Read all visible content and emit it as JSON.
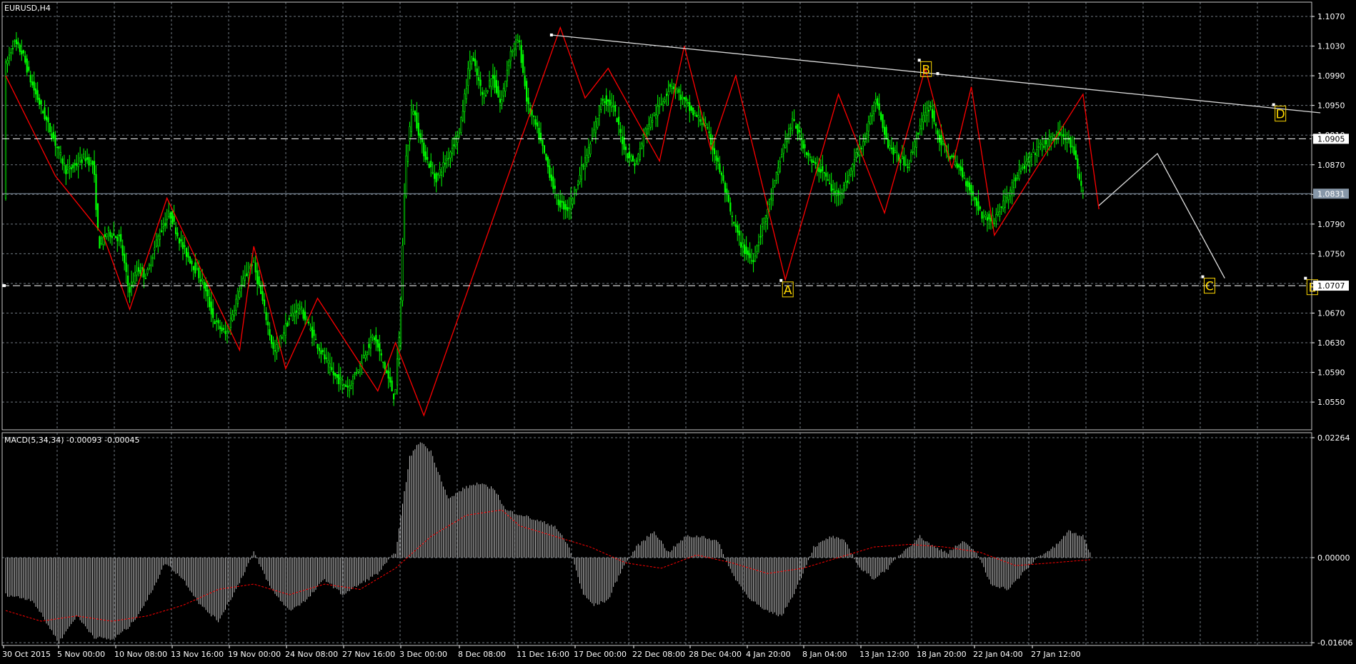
{
  "chart_data": [
    {
      "type": "candlestick",
      "title": "EURUSD,H4",
      "symbol": "EURUSD",
      "timeframe": "H4",
      "ylim": [
        1.0515,
        1.072
      ],
      "yticks": [
        "1.1070",
        "1.1030",
        "1.0990",
        "1.0950",
        "1.0910",
        "1.0870",
        "1.0830",
        "1.0790",
        "1.0750",
        "1.0710",
        "1.0670",
        "1.0630",
        "1.0590",
        "1.0550"
      ],
      "grid": true,
      "x_labels": [
        "30 Oct 2015",
        "5 Nov 00:00",
        "10 Nov 08:00",
        "13 Nov 16:00",
        "19 Nov 00:00",
        "24 Nov 08:00",
        "27 Nov 16:00",
        "3 Dec 00:00",
        "8 Dec 08:00",
        "11 Dec 16:00",
        "17 Dec 00:00",
        "22 Dec 08:00",
        "28 Dec 04:00",
        "4 Jan 20:00",
        "8 Jan 04:00",
        "13 Jan 12:00",
        "18 Jan 20:00",
        "22 Jan 04:00",
        "27 Jan 12:00"
      ],
      "price_path": [
        [
          0,
          1.1
        ],
        [
          5,
          1.1035
        ],
        [
          10,
          1.102
        ],
        [
          15,
          1.098
        ],
        [
          20,
          1.095
        ],
        [
          25,
          1.092
        ],
        [
          30,
          1.089
        ],
        [
          35,
          1.086
        ],
        [
          40,
          1.087
        ],
        [
          45,
          1.088
        ],
        [
          50,
          1.087
        ],
        [
          53,
          1.076
        ],
        [
          58,
          1.078
        ],
        [
          65,
          1.077
        ],
        [
          70,
          1.07
        ],
        [
          75,
          1.073
        ],
        [
          80,
          1.072
        ],
        [
          86,
          1.077
        ],
        [
          93,
          1.0805
        ],
        [
          100,
          1.076
        ],
        [
          105,
          1.074
        ],
        [
          112,
          1.071
        ],
        [
          118,
          1.066
        ],
        [
          125,
          1.064
        ],
        [
          132,
          1.07
        ],
        [
          140,
          1.074
        ],
        [
          146,
          1.068
        ],
        [
          152,
          1.0615
        ],
        [
          160,
          1.066
        ],
        [
          166,
          1.068
        ],
        [
          172,
          1.065
        ],
        [
          178,
          1.062
        ],
        [
          186,
          1.0585
        ],
        [
          194,
          1.057
        ],
        [
          200,
          1.06
        ],
        [
          208,
          1.064
        ],
        [
          214,
          1.06
        ],
        [
          220,
          1.0555
        ],
        [
          223,
          1.065
        ],
        [
          226,
          1.087
        ],
        [
          230,
          1.095
        ],
        [
          236,
          1.089
        ],
        [
          243,
          1.085
        ],
        [
          250,
          1.088
        ],
        [
          257,
          1.092
        ],
        [
          263,
          1.102
        ],
        [
          270,
          1.096
        ],
        [
          275,
          1.099
        ],
        [
          280,
          1.095
        ],
        [
          285,
          1.102
        ],
        [
          290,
          1.104
        ],
        [
          295,
          1.095
        ],
        [
          300,
          1.092
        ],
        [
          305,
          1.088
        ],
        [
          312,
          1.082
        ],
        [
          318,
          1.081
        ],
        [
          325,
          1.086
        ],
        [
          331,
          1.09
        ],
        [
          337,
          1.096
        ],
        [
          343,
          1.095
        ],
        [
          350,
          1.089
        ],
        [
          356,
          1.087
        ],
        [
          362,
          1.092
        ],
        [
          370,
          1.095
        ],
        [
          376,
          1.098
        ],
        [
          382,
          1.096
        ],
        [
          388,
          1.094
        ],
        [
          395,
          1.0925
        ],
        [
          400,
          1.089
        ],
        [
          405,
          1.085
        ],
        [
          410,
          1.08
        ],
        [
          416,
          1.076
        ],
        [
          422,
          1.074
        ],
        [
          428,
          1.079
        ],
        [
          434,
          1.084
        ],
        [
          440,
          1.09
        ],
        [
          445,
          1.093
        ],
        [
          450,
          1.09
        ],
        [
          456,
          1.087
        ],
        [
          462,
          1.086
        ],
        [
          468,
          1.083
        ],
        [
          474,
          1.084
        ],
        [
          480,
          1.088
        ],
        [
          486,
          1.091
        ],
        [
          492,
          1.096
        ],
        [
          498,
          1.09
        ],
        [
          504,
          1.088
        ],
        [
          510,
          1.087
        ],
        [
          516,
          1.092
        ],
        [
          522,
          1.095
        ],
        [
          528,
          1.09
        ],
        [
          534,
          1.088
        ],
        [
          540,
          1.086
        ],
        [
          546,
          1.083
        ],
        [
          552,
          1.08
        ],
        [
          558,
          1.0795
        ],
        [
          564,
          1.082
        ],
        [
          570,
          1.085
        ],
        [
          576,
          1.087
        ],
        [
          582,
          1.089
        ],
        [
          588,
          1.09
        ],
        [
          594,
          1.091
        ],
        [
          600,
          1.0905
        ],
        [
          604,
          1.088
        ],
        [
          608,
          1.0831
        ]
      ],
      "zigzag": [
        [
          0,
          1.099
        ],
        [
          28,
          1.0855
        ],
        [
          55,
          1.0775
        ],
        [
          70,
          1.0675
        ],
        [
          91,
          1.0825
        ],
        [
          132,
          1.062
        ],
        [
          140,
          1.076
        ],
        [
          158,
          1.0595
        ],
        [
          176,
          1.069
        ],
        [
          210,
          1.0565
        ],
        [
          220,
          1.063
        ],
        [
          236,
          1.0532
        ],
        [
          313,
          1.1055
        ],
        [
          327,
          1.096
        ],
        [
          340,
          1.1
        ],
        [
          369,
          1.0875
        ],
        [
          383,
          1.103
        ],
        [
          398,
          1.089
        ],
        [
          412,
          1.099
        ],
        [
          440,
          1.0715
        ],
        [
          470,
          1.0965
        ],
        [
          496,
          1.0805
        ],
        [
          519,
          1.1
        ],
        [
          534,
          1.0865
        ],
        [
          545,
          1.0975
        ],
        [
          558,
          1.0775
        ],
        [
          608,
          1.0965
        ],
        [
          617,
          1.081
        ]
      ],
      "trendline": {
        "from": [
          308,
          1.1045
        ],
        "to": [
          742,
          1.094
        ],
        "color": "#d8d8d8"
      },
      "projection": [
        [
          617,
          1.0815
        ],
        [
          650,
          1.0885
        ],
        [
          688,
          1.0717
        ]
      ],
      "hlines": [
        {
          "label": "1.0905",
          "value": 1.0905,
          "style": "dashed",
          "color": "#ffffff"
        },
        {
          "label": "1.0831",
          "value": 1.0831,
          "style": "solid",
          "color": "#8797a8"
        },
        {
          "label": "1.0707",
          "value": 1.0707,
          "style": "dashed",
          "color": "#ffffff"
        }
      ],
      "wave_labels": [
        {
          "label": "A",
          "x": 438,
          "value": 1.0713
        },
        {
          "label": "B",
          "x": 516,
          "value": 1.101
        },
        {
          "label": "C",
          "x": 676,
          "value": 1.0718
        },
        {
          "label": "D",
          "x": 716,
          "value": 1.095
        },
        {
          "label": "E",
          "x": 734,
          "value": 1.0716
        }
      ],
      "colors": {
        "candles": "#00ff00",
        "zigzag": "#ff0000",
        "grid": "#707880",
        "axis": "#ffffff",
        "label": "#ffd800"
      }
    },
    {
      "type": "histogram",
      "title": "MACD(5,34,34) -0.00093 -0.00045",
      "yticks": [
        "0.02264",
        "0.00000",
        "-0.01606"
      ],
      "ylim": [
        -0.01606,
        0.02264
      ],
      "histogram": [
        [
          0,
          -0.007
        ],
        [
          15,
          -0.008
        ],
        [
          30,
          -0.016
        ],
        [
          40,
          -0.011
        ],
        [
          50,
          -0.015
        ],
        [
          60,
          -0.0155
        ],
        [
          70,
          -0.013
        ],
        [
          80,
          -0.008
        ],
        [
          90,
          -0.001
        ],
        [
          100,
          -0.004
        ],
        [
          110,
          -0.009
        ],
        [
          120,
          -0.012
        ],
        [
          130,
          -0.006
        ],
        [
          140,
          0.001
        ],
        [
          150,
          -0.006
        ],
        [
          160,
          -0.01
        ],
        [
          170,
          -0.008
        ],
        [
          180,
          -0.004
        ],
        [
          190,
          -0.007
        ],
        [
          200,
          -0.005
        ],
        [
          210,
          -0.003
        ],
        [
          220,
          0.001
        ],
        [
          228,
          0.019
        ],
        [
          234,
          0.022
        ],
        [
          240,
          0.02
        ],
        [
          250,
          0.011
        ],
        [
          258,
          0.013
        ],
        [
          266,
          0.014
        ],
        [
          276,
          0.013
        ],
        [
          282,
          0.009
        ],
        [
          292,
          0.008
        ],
        [
          300,
          0.007
        ],
        [
          310,
          0.006
        ],
        [
          318,
          0.002
        ],
        [
          326,
          -0.007
        ],
        [
          332,
          -0.009
        ],
        [
          340,
          -0.008
        ],
        [
          348,
          -0.002
        ],
        [
          356,
          0.002
        ],
        [
          366,
          0.005
        ],
        [
          374,
          0.001
        ],
        [
          384,
          0.004
        ],
        [
          394,
          0.004
        ],
        [
          402,
          0.003
        ],
        [
          410,
          -0.003
        ],
        [
          418,
          -0.007
        ],
        [
          428,
          -0.01
        ],
        [
          438,
          -0.011
        ],
        [
          446,
          -0.006
        ],
        [
          456,
          0.002
        ],
        [
          466,
          0.004
        ],
        [
          474,
          0.003
        ],
        [
          482,
          -0.002
        ],
        [
          490,
          -0.004
        ],
        [
          498,
          -0.002
        ],
        [
          506,
          0.001
        ],
        [
          516,
          0.004
        ],
        [
          524,
          0.002
        ],
        [
          532,
          0.001
        ],
        [
          540,
          0.003
        ],
        [
          548,
          0.001
        ],
        [
          556,
          -0.005
        ],
        [
          566,
          -0.006
        ],
        [
          574,
          -0.003
        ],
        [
          582,
          0.0
        ],
        [
          592,
          0.002
        ],
        [
          600,
          0.005
        ],
        [
          608,
          0.004
        ],
        [
          612,
          0.001
        ]
      ],
      "signal": [
        [
          0,
          -0.01
        ],
        [
          20,
          -0.012
        ],
        [
          40,
          -0.011
        ],
        [
          60,
          -0.012
        ],
        [
          80,
          -0.011
        ],
        [
          100,
          -0.009
        ],
        [
          120,
          -0.006
        ],
        [
          140,
          -0.005
        ],
        [
          160,
          -0.007
        ],
        [
          180,
          -0.005
        ],
        [
          200,
          -0.006
        ],
        [
          220,
          -0.002
        ],
        [
          240,
          0.004
        ],
        [
          260,
          0.008
        ],
        [
          280,
          0.009
        ],
        [
          290,
          0.006
        ],
        [
          310,
          0.004
        ],
        [
          330,
          0.002
        ],
        [
          350,
          -0.001
        ],
        [
          370,
          -0.002
        ],
        [
          390,
          0.0005
        ],
        [
          410,
          -0.001
        ],
        [
          430,
          -0.003
        ],
        [
          450,
          -0.002
        ],
        [
          470,
          0.0
        ],
        [
          490,
          0.002
        ],
        [
          510,
          0.0025
        ],
        [
          530,
          0.002
        ],
        [
          550,
          0.001
        ],
        [
          570,
          -0.0015
        ],
        [
          590,
          -0.001
        ],
        [
          612,
          -0.0004
        ]
      ],
      "colors": {
        "histogram": "#c0c0c0",
        "signal": "#ff0000"
      }
    }
  ]
}
